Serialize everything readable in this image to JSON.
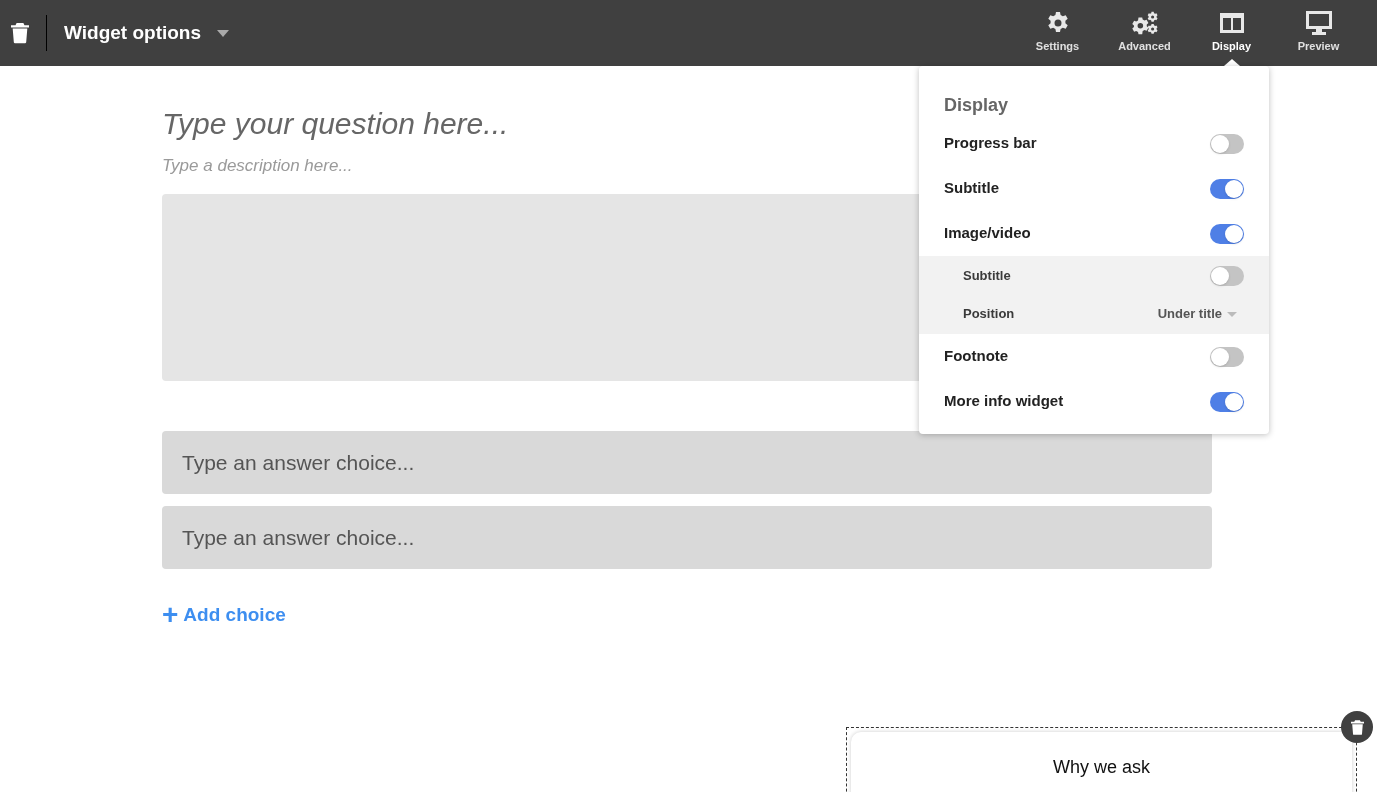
{
  "toolbar": {
    "title": "Widget options",
    "tabs": [
      {
        "kind": "gear",
        "label": "Settings",
        "selected": false
      },
      {
        "kind": "gears",
        "label": "Advanced",
        "selected": false
      },
      {
        "kind": "columns",
        "label": "Display",
        "selected": true
      },
      {
        "kind": "monitor",
        "label": "Preview",
        "selected": false
      }
    ]
  },
  "question": {
    "title_placeholder": "Type your question here...",
    "description_placeholder": "Type a description here..."
  },
  "answers": [
    {
      "placeholder": "Type an answer choice..."
    },
    {
      "placeholder": "Type an answer choice..."
    }
  ],
  "add_choice": {
    "icon": "+",
    "label": "Add choice"
  },
  "display_panel": {
    "title": "Display",
    "options": [
      {
        "kind": "toggle",
        "label": "Progress bar",
        "on": false
      },
      {
        "kind": "toggle",
        "label": "Subtitle",
        "on": true
      },
      {
        "kind": "toggle",
        "label": "Image/video",
        "on": true,
        "children": [
          {
            "kind": "toggle",
            "label": "Subtitle",
            "on": false
          },
          {
            "kind": "select",
            "label": "Position",
            "value": "Under title"
          }
        ]
      },
      {
        "kind": "toggle",
        "label": "Footnote",
        "on": false
      },
      {
        "kind": "toggle",
        "label": "More info widget",
        "on": true
      }
    ]
  },
  "info_card": {
    "title": "Why we ask"
  }
}
